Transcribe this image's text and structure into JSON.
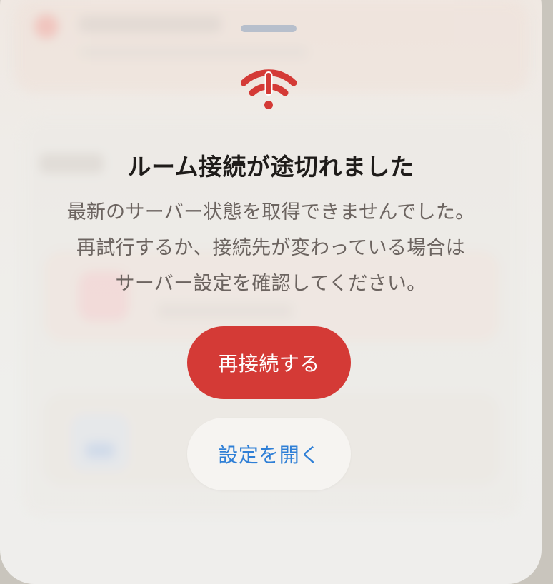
{
  "dialog": {
    "icon": "wifi-exclamation-icon",
    "title": "ルーム接続が途切れました",
    "message_lines": [
      "最新のサーバー状態を取得できませんでした。",
      "再試行するか、接続先が変わっている場合は",
      "サーバー設定を確認してください。"
    ],
    "primary_button": "再接続する",
    "secondary_button": "設定を開く"
  },
  "colors": {
    "accent_red": "#d43a36",
    "link_blue": "#2f7fd6",
    "title_text": "#1f1c1a",
    "body_text": "#6c6460"
  }
}
